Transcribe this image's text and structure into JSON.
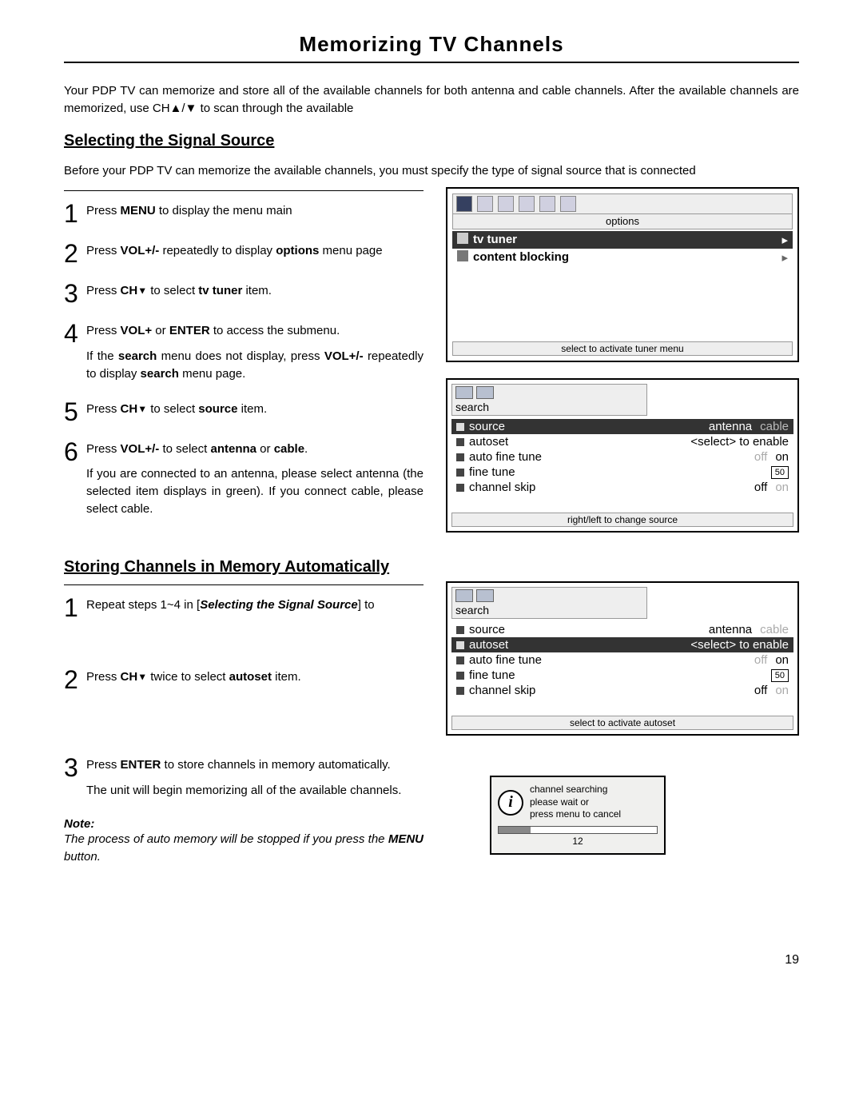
{
  "title": "Memorizing TV Channels",
  "intro": "Your PDP TV can memorize and store all of the available channels for both antenna and cable channels. After the  available channels are memorized, use CH▲/▼ to scan through the available",
  "pageNum": "19",
  "sel": {
    "heading": "Selecting the Signal Source",
    "sub": "Before your PDP TV can memorize the available channels, you must specify the type of signal source that is connected",
    "s1_a": "Press ",
    "s1_b": "MENU",
    "s1_c": " to display the menu main",
    "s2_a": "Press ",
    "s2_b": "VOL+/-",
    "s2_c": " repeatedly to display ",
    "s2_d": "options",
    "s2_e": " menu page",
    "s3_a": "Press ",
    "s3_b": "CH",
    "s3_b2": "▼",
    "s3_c": " to select ",
    "s3_d": "tv tuner",
    "s3_e": " item.",
    "s4_a": "Press ",
    "s4_b": "VOL+",
    "s4_c": " or ",
    "s4_d": "ENTER",
    "s4_e": " to access the submenu.",
    "s4_f": "If the ",
    "s4_g": "search",
    "s4_h": " menu does not display, press ",
    "s4_i": "VOL+/-",
    "s4_j": " repeatedly to display ",
    "s4_k": "search",
    "s4_l": " menu page.",
    "s5_a": "Press ",
    "s5_b": "CH",
    "s5_b2": "▼",
    "s5_c": " to select ",
    "s5_d": "source",
    "s5_e": " item.",
    "s6_a": "Press ",
    "s6_b": "VOL+/-",
    "s6_c": " to select ",
    "s6_d": "antenna",
    "s6_e": " or ",
    "s6_f": "cable",
    "s6_g": ".",
    "s6_note": "If you are connected to an antenna, please select antenna (the selected item displays in green). If you connect cable, please select cable."
  },
  "sto": {
    "heading": "Storing Channels in Memory Automatically",
    "s1_a": "Repeat steps 1~4 in [",
    "s1_b": "Selecting the Signal Source",
    "s1_c": "] to",
    "s2_a": "Press ",
    "s2_b": "CH",
    "s2_b2": "▼",
    "s2_c": " twice to select ",
    "s2_d": "autoset",
    "s2_e": " item.",
    "s3_a": "Press ",
    "s3_b": "ENTER",
    "s3_c": " to store channels in memory automatically.",
    "s3_d": "The unit will begin memorizing all of the available channels.",
    "noteLabel": "Note:",
    "noteText_a": "The process of auto memory will be stopped if you press the ",
    "noteText_b": "MENU",
    "noteText_c": " button."
  },
  "osd1": {
    "tabLabel": "options",
    "r1": "tv tuner",
    "r2": "content blocking",
    "footer": "select to activate tuner menu"
  },
  "osd2": {
    "tabLabel": "search",
    "rows": {
      "source": {
        "label": "source",
        "v1": "antenna",
        "v2": "cable"
      },
      "autoset": {
        "label": "autoset",
        "v": "<select> to enable"
      },
      "aft": {
        "label": "auto fine tune",
        "off": "off",
        "on": "on"
      },
      "fine": {
        "label": "fine tune",
        "pill": "50"
      },
      "skip": {
        "label": "channel skip",
        "off": "off",
        "on": "on"
      }
    },
    "footer": "right/left to change source"
  },
  "osd3": {
    "tabLabel": "search",
    "rows": {
      "source": {
        "label": "source",
        "v1": "antenna",
        "v2": "cable"
      },
      "autoset": {
        "label": "autoset",
        "v": "<select> to enable"
      },
      "aft": {
        "label": "auto fine tune",
        "off": "off",
        "on": "on"
      },
      "fine": {
        "label": "fine tune",
        "pill": "50"
      },
      "skip": {
        "label": "channel skip",
        "off": "off",
        "on": "on"
      }
    },
    "footer": "select to activate autoset"
  },
  "popup": {
    "l1": "channel searching",
    "l2": "please wait or",
    "l3": "press menu to cancel",
    "progress": "12"
  }
}
